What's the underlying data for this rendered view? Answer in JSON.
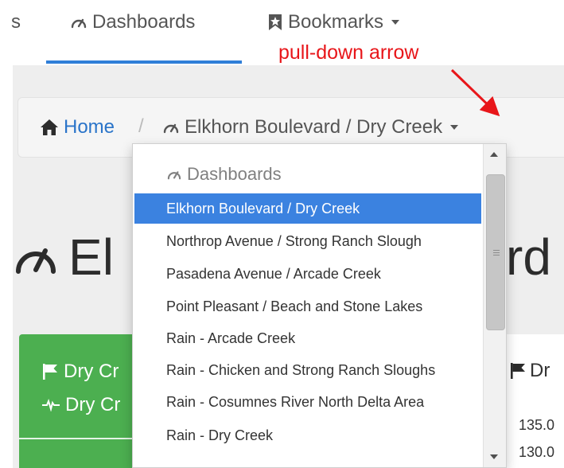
{
  "nav": {
    "partial_item": "s",
    "dashboards_label": "Dashboards",
    "bookmarks_label": "Bookmarks"
  },
  "annotation": {
    "text": "pull-down arrow",
    "color": "#e8161a"
  },
  "breadcrumb": {
    "home_label": "Home",
    "separator": "/",
    "current_label": "Elkhorn Boulevard / Dry Creek"
  },
  "dropdown": {
    "header": "Dashboards",
    "items": [
      {
        "label": "Elkhorn Boulevard / Dry Creek",
        "active": true
      },
      {
        "label": "Northrop Avenue / Strong Ranch Slough",
        "active": false
      },
      {
        "label": "Pasadena Avenue / Arcade Creek",
        "active": false
      },
      {
        "label": "Point Pleasant / Beach and Stone Lakes",
        "active": false
      },
      {
        "label": "Rain - Arcade Creek",
        "active": false
      },
      {
        "label": "Rain - Chicken and Strong Ranch Sloughs",
        "active": false
      },
      {
        "label": "Rain - Cosumnes River North Delta Area",
        "active": false
      },
      {
        "label": "Rain - Dry Creek",
        "active": false
      }
    ]
  },
  "page": {
    "title_partial_left": "El",
    "title_partial_right": "rd"
  },
  "panel_green": {
    "row1_label": "Dry Cr",
    "row2_label": "Dry Cr",
    "color": "#4caf50"
  },
  "panel_right": {
    "title_partial": "Dr",
    "values": [
      "135.0",
      "130.0"
    ]
  },
  "colors": {
    "accent": "#2f7ed8",
    "link": "#2a74c9",
    "selection": "#3b82e0"
  }
}
